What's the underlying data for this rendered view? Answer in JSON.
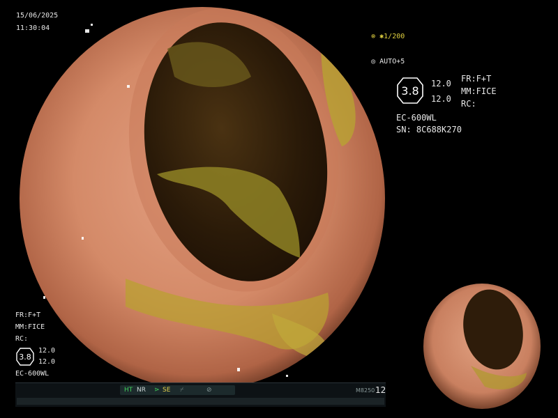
{
  "timestamp": {
    "date": "15/06/2025",
    "time": "11:30:04"
  },
  "exposure": {
    "shutter": "1/200",
    "auto": "AUTO+5"
  },
  "settings": {
    "structure_value": "3.8",
    "enhance_a": "12.0",
    "enhance_b": "12.0",
    "fr": "FR:F+T",
    "mm": "MM:FICE",
    "rc": "RC:",
    "scope_model": "EC-600WL",
    "serial": "SN: 8C688K270"
  },
  "left_panel": {
    "fr": "FR:F+T",
    "mm": "MM:FICE",
    "rc": "RC:",
    "structure_value": "3.8",
    "enhance_a": "12.0",
    "enhance_b": "12.0",
    "scope_model": "EC-600WL"
  },
  "status_bar": {
    "ht": "HT",
    "nr": "NR",
    "se": "SE",
    "code": "M8250",
    "number": "12"
  },
  "colors": {
    "mucosa": "#d88a6a",
    "lumen": "#2a1608",
    "stool": "#a89a2a",
    "overlay_text": "#e8e8e8",
    "ht_green": "#3fd15a",
    "se_yellow": "#e6d24a"
  }
}
